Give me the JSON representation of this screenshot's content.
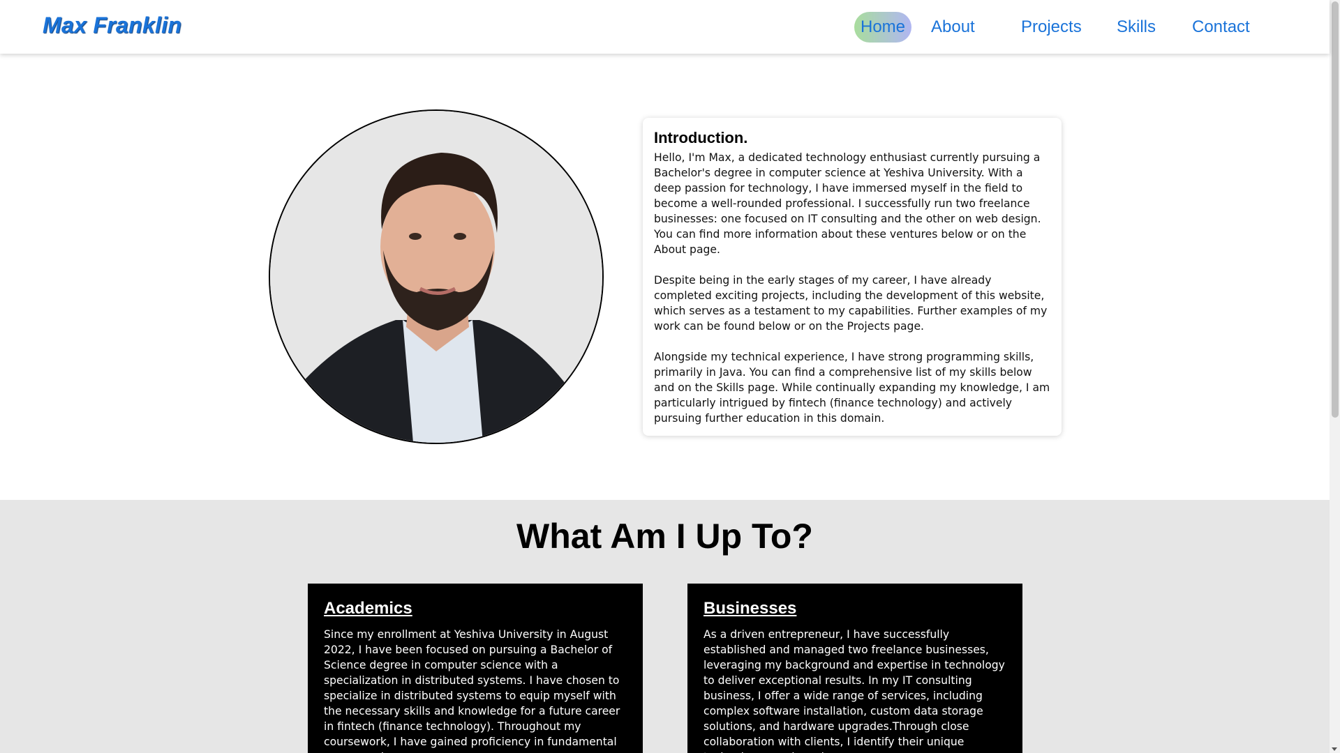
{
  "header": {
    "brand": "Max Franklin",
    "nav": [
      {
        "label": "Home",
        "active": true
      },
      {
        "label": "About",
        "active": false
      },
      {
        "label": "Projects",
        "active": false
      },
      {
        "label": "Skills",
        "active": false
      },
      {
        "label": "Contact",
        "active": false
      }
    ]
  },
  "intro": {
    "title": "Introduction.",
    "paragraphs": [
      "Hello, I'm Max, a dedicated technology enthusiast currently pursuing a Bachelor's degree in computer science at Yeshiva University. With a deep passion for technology, I have immersed myself in the field to become a well-rounded professional. I successfully run two freelance businesses: one focused on IT consulting and the other on web design. You can find more information about these ventures below or on the About page.",
      "Despite being in the early stages of my career, I have already completed exciting projects, including the development of this website, which serves as a testament to my capabilities. Further examples of my work can be found below or on the Projects page.",
      "Alongside my technical experience, I have strong programming skills, primarily in Java. You can find a comprehensive list of my skills below and on the Skills page. While continually expanding my knowledge, I am particularly intrigued by fintech (finance technology) and actively pursuing further education in this domain."
    ]
  },
  "section": {
    "title": "What Am I Up To?",
    "cards": [
      {
        "title": "Academics",
        "text": "Since my enrollment at Yeshiva University in August 2022, I have been focused on pursuing a Bachelor of Science degree in computer science with a specialization in distributed systems. I have chosen to specialize in distributed systems to equip myself with the necessary skills and knowledge for a future career in fintech (finance technology). Throughout my coursework, I have gained proficiency in fundamental programming"
      },
      {
        "title": "Businesses",
        "text": "As a driven entrepreneur, I have successfully established and managed two freelance businesses, leveraging my background and expertise in technology to deliver exceptional results. In my IT consulting business, I offer a wide range of services, including complex software installation, custom data storage solutions, and hardware upgrades.Through close collaboration with clients, I identify their unique technology needs and"
      }
    ]
  },
  "colors": {
    "brand": "#1a73d9",
    "nav_active_gradient_start": "#a9dd9d",
    "nav_active_gradient_end": "#b0b6f2",
    "section_bg": "#e6e6e6",
    "card_bg": "#000000"
  },
  "icons": {
    "scrollbar_arrow": "chevron-down-icon"
  }
}
